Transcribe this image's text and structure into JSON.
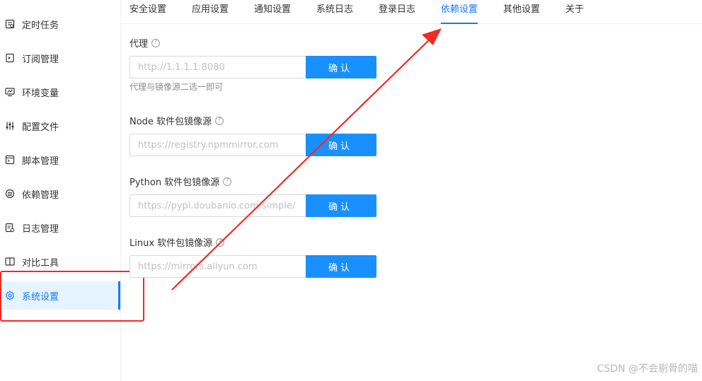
{
  "sidebar": {
    "items": [
      {
        "label": "定时任务",
        "icon": "calendar-icon"
      },
      {
        "label": "订阅管理",
        "icon": "subscription-icon"
      },
      {
        "label": "环境变量",
        "icon": "monitor-icon"
      },
      {
        "label": "配置文件",
        "icon": "sliders-icon"
      },
      {
        "label": "脚本管理",
        "icon": "code-file-icon"
      },
      {
        "label": "依赖管理",
        "icon": "database-icon"
      },
      {
        "label": "日志管理",
        "icon": "log-icon"
      },
      {
        "label": "对比工具",
        "icon": "diff-icon"
      },
      {
        "label": "系统设置",
        "icon": "gear-icon",
        "active": true
      }
    ]
  },
  "tabs": [
    {
      "label": "安全设置"
    },
    {
      "label": "应用设置"
    },
    {
      "label": "通知设置"
    },
    {
      "label": "系统日志"
    },
    {
      "label": "登录日志"
    },
    {
      "label": "依赖设置",
      "active": true
    },
    {
      "label": "其他设置"
    },
    {
      "label": "关于"
    }
  ],
  "form": {
    "proxy": {
      "label": "代理",
      "placeholder": "http://1.1.1.1:8080",
      "button": "确认",
      "hint": "代理与镜像源二选一即可"
    },
    "node": {
      "label": "Node 软件包镜像源",
      "placeholder": "https://registry.npmmirror.com",
      "button": "确认"
    },
    "python": {
      "label": "Python 软件包镜像源",
      "placeholder": "https://pypi.doubanio.com/simple/",
      "button": "确认"
    },
    "linux": {
      "label": "Linux 软件包镜像源",
      "placeholder": "https://mirrors.aliyun.com",
      "button": "确认"
    },
    "help_glyph": "?"
  },
  "colors": {
    "accent": "#1677ff",
    "button": "#1890ff",
    "annotation": "#ee2b24"
  },
  "watermark": "CSDN @不会剔骨的喵"
}
